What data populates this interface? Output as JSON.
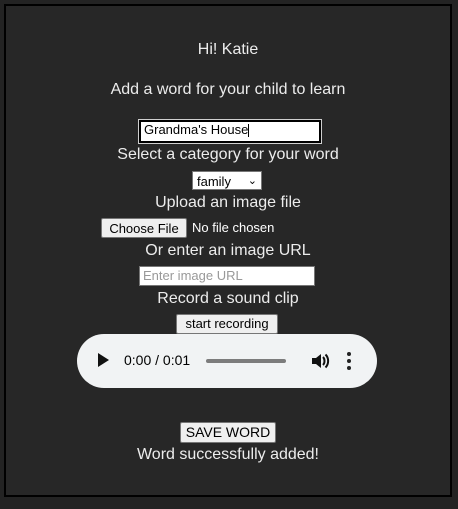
{
  "greeting": "Hi! Katie",
  "instruction": "Add a word for your child to learn",
  "word_input": {
    "value": "Grandma's House"
  },
  "category": {
    "label": "Select a category for your word",
    "selected": "family"
  },
  "upload": {
    "label": "Upload an image file",
    "button": "Choose File",
    "status": "No file chosen"
  },
  "image_url": {
    "label": "Or enter an image URL",
    "placeholder": "Enter image URL"
  },
  "record": {
    "label": "Record a sound clip",
    "button": "start recording"
  },
  "audio": {
    "time": "0:00 / 0:01"
  },
  "save_button": "SAVE WORD",
  "message": "Word successfully added!",
  "colors": {
    "background": "#272727",
    "text": "#ececec",
    "player": "#f1f3f4"
  }
}
